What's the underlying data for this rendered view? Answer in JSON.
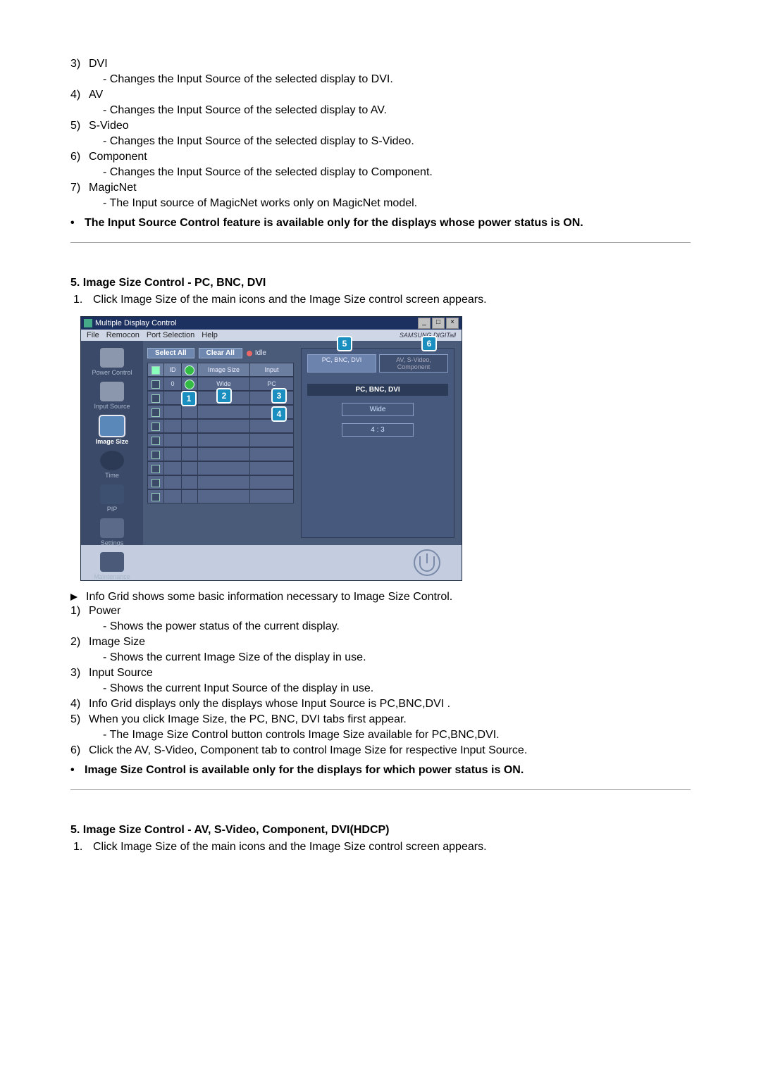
{
  "section3": {
    "items": [
      {
        "num": "3)",
        "title": "DVI",
        "desc": "- Changes the Input Source of the selected display to DVI."
      },
      {
        "num": "4)",
        "title": "AV",
        "desc": "- Changes the Input Source of the selected display to AV."
      },
      {
        "num": "5)",
        "title": "S-Video",
        "desc": "- Changes the Input Source of the selected display to S-Video."
      },
      {
        "num": "6)",
        "title": "Component",
        "desc": "- Changes the Input Source of the selected display to Component."
      },
      {
        "num": "7)",
        "title": "MagicNet",
        "desc": "- The Input source of MagicNet works only on MagicNet model."
      }
    ],
    "bullet": "The Input Source Control feature is available only for the displays whose power status is ON."
  },
  "section5a": {
    "heading": "5. Image Size Control - PC, BNC, DVI",
    "step1_num": "1.",
    "step1_text": "Click Image Size of the main icons and the Image Size control screen appears.",
    "lead_arrow_text": "Info Grid shows some basic information necessary to Image Size Control.",
    "items": [
      {
        "num": "1)",
        "title": "Power",
        "desc": "- Shows the power status of the current display."
      },
      {
        "num": "2)",
        "title": "Image Size",
        "desc": "- Shows the current Image Size of the display in use."
      },
      {
        "num": "3)",
        "title": "Input Source",
        "desc": "- Shows the current Input Source of the display in use."
      },
      {
        "num": "4)",
        "title": "Info Grid displays only the displays whose Input Source is PC,BNC,DVI .",
        "desc": null
      },
      {
        "num": "5)",
        "title": "When you click Image Size, the PC, BNC, DVI tabs first appear.",
        "desc": "- The Image Size Control button controls Image Size available for PC,BNC,DVI."
      },
      {
        "num": "6)",
        "title": "Click the AV, S-Video, Component tab to control Image Size for respective Input Source.",
        "desc": null
      }
    ],
    "bullet": "Image Size Control is available only for the displays for which power status is ON."
  },
  "section5b": {
    "heading": "5. Image Size Control - AV, S-Video, Component, DVI(HDCP)",
    "step1_num": "1.",
    "step1_text": "Click Image Size of the main icons and the Image Size control screen appears."
  },
  "app": {
    "title": "Multiple Display Control",
    "menu": {
      "file": "File",
      "remocon": "Remocon",
      "port": "Port Selection",
      "help": "Help"
    },
    "brand": "SAMSUNG DIGITall",
    "sidebar": {
      "power": "Power Control",
      "input": "Input Source",
      "image": "Image Size",
      "time": "Time",
      "pip": "PIP",
      "set": "Settings",
      "maint": "Maintenance"
    },
    "btn_select_all": "Select All",
    "btn_clear_all": "Clear All",
    "idle": "Idle",
    "cols": {
      "chk": "",
      "id": "ID",
      "pw": "",
      "size": "Image Size",
      "input": "Input"
    },
    "row0": {
      "id": "0",
      "size": "Wide",
      "input": "PC"
    },
    "tabs": {
      "left": "PC, BNC, DVI",
      "right": "AV, S-Video, Component"
    },
    "panel_label": "PC, BNC, DVI",
    "opt_wide": "Wide",
    "opt_43": "4 : 3",
    "callouts": {
      "c1": "1",
      "c2": "2",
      "c3": "3",
      "c4": "4",
      "c5": "5",
      "c6": "6"
    },
    "win_btns": {
      "min": "_",
      "max": "□",
      "close": "×"
    }
  }
}
